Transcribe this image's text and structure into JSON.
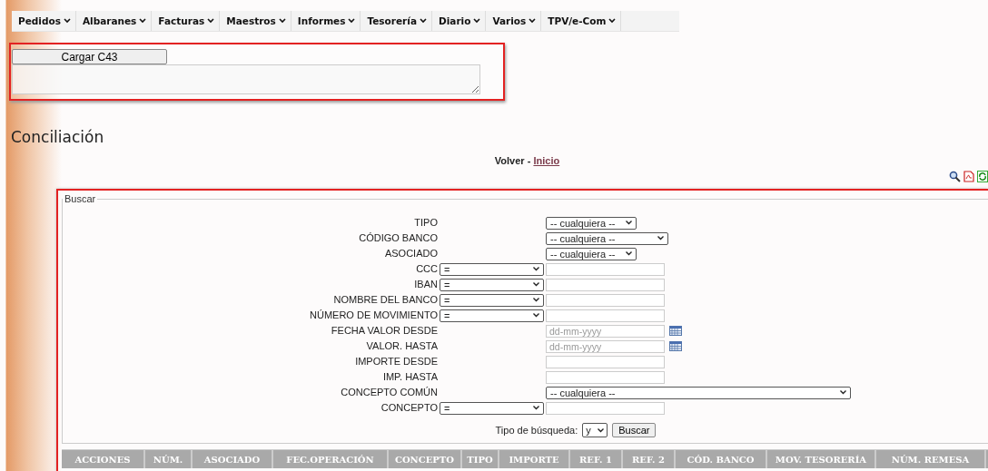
{
  "menu": [
    {
      "label": "Pedidos"
    },
    {
      "label": "Albaranes"
    },
    {
      "label": "Facturas"
    },
    {
      "label": "Maestros"
    },
    {
      "label": "Informes"
    },
    {
      "label": "Tesorería"
    },
    {
      "label": "Diario"
    },
    {
      "label": "Varios"
    },
    {
      "label": "TPV/e-Com"
    }
  ],
  "upload": {
    "button": "Cargar C43"
  },
  "title": "Conciliación",
  "nav": {
    "back": "Volver",
    "separator": "-",
    "link": "Inicio"
  },
  "search": {
    "legend": "Buscar",
    "fields": [
      {
        "kind": "select",
        "label": "TIPO",
        "value": "-- cualquiera --"
      },
      {
        "kind": "select",
        "label": "CÓDIGO BANCO",
        "value": "-- cualquiera --"
      },
      {
        "kind": "select",
        "label": "ASOCIADO",
        "value": "-- cualquiera --"
      },
      {
        "kind": "operator",
        "label": "CCC",
        "operator": "="
      },
      {
        "kind": "operator",
        "label": "IBAN",
        "operator": "="
      },
      {
        "kind": "operator",
        "label": "NOMBRE DEL BANCO",
        "operator": "="
      },
      {
        "kind": "operator",
        "label": "NÚMERO DE MOVIMIENTO",
        "operator": "="
      },
      {
        "kind": "date",
        "label": "FECHA VALOR DESDE",
        "placeholder": "dd-mm-yyyy"
      },
      {
        "kind": "date",
        "label": "VALOR. HASTA",
        "placeholder": "dd-mm-yyyy"
      },
      {
        "kind": "text",
        "label": "IMPORTE DESDE"
      },
      {
        "kind": "text",
        "label": "IMP. HASTA"
      },
      {
        "kind": "select",
        "label": "CONCEPTO COMÚN",
        "value": "-- cualquiera --"
      },
      {
        "kind": "operator",
        "label": "CONCEPTO",
        "operator": "="
      }
    ],
    "mode_label": "Tipo de búsqueda:",
    "mode_value": "y",
    "submit": "Buscar"
  },
  "table": {
    "columns": [
      "ACCIONES",
      "NÚM.",
      "ASOCIADO",
      "FEC.OPERACIÓN",
      "CONCEPTO",
      "TIPO",
      "IMPORTE",
      "REF. 1",
      "REF. 2",
      "CÓD. BANCO",
      "MOV. TESORERÍA",
      "NÚM. REMESA"
    ]
  }
}
